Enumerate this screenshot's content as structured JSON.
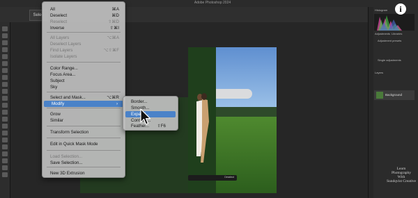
{
  "app": {
    "title": "Adobe Photoshop 2024"
  },
  "options_bar": {
    "select_label": "Selec"
  },
  "select_menu": {
    "items": [
      {
        "label": "All",
        "shortcut": "⌘A",
        "disabled": false
      },
      {
        "label": "Deselect",
        "shortcut": "⌘D",
        "disabled": false
      },
      {
        "label": "Reselect",
        "shortcut": "⇧⌘D",
        "disabled": true
      },
      {
        "label": "Inverse",
        "shortcut": "⇧⌘I",
        "disabled": false
      },
      {
        "label": "All Layers",
        "shortcut": "⌥⌘A",
        "disabled": true
      },
      {
        "label": "Deselect Layers",
        "shortcut": "",
        "disabled": true
      },
      {
        "label": "Find Layers",
        "shortcut": "⌥⇧⌘F",
        "disabled": true
      },
      {
        "label": "Isolate Layers",
        "shortcut": "",
        "disabled": true
      },
      {
        "label": "Color Range...",
        "shortcut": "",
        "disabled": false
      },
      {
        "label": "Focus Area...",
        "shortcut": "",
        "disabled": false
      },
      {
        "label": "Subject",
        "shortcut": "",
        "disabled": false
      },
      {
        "label": "Sky",
        "shortcut": "",
        "disabled": false
      },
      {
        "label": "Select and Mask...",
        "shortcut": "⌥⌘R",
        "disabled": false
      },
      {
        "label": "Modify",
        "shortcut": "›",
        "disabled": false,
        "highlighted": true
      },
      {
        "label": "Grow",
        "shortcut": "",
        "disabled": false
      },
      {
        "label": "Similar",
        "shortcut": "",
        "disabled": false
      },
      {
        "label": "Transform Selection",
        "shortcut": "",
        "disabled": false
      },
      {
        "label": "Edit in Quick Mask Mode",
        "shortcut": "",
        "disabled": false
      },
      {
        "label": "Load Selection...",
        "shortcut": "",
        "disabled": true
      },
      {
        "label": "Save Selection...",
        "shortcut": "",
        "disabled": false
      },
      {
        "label": "New 3D Extrusion",
        "shortcut": "",
        "disabled": false
      }
    ]
  },
  "modify_submenu": {
    "items": [
      {
        "label": "Border...",
        "highlighted": false
      },
      {
        "label": "Smooth...",
        "highlighted": false
      },
      {
        "label": "Expand...",
        "highlighted": true
      },
      {
        "label": "Contract...",
        "highlighted": false
      },
      {
        "label": "Feather...",
        "shortcut": "⇧F6",
        "highlighted": false
      }
    ]
  },
  "panels": {
    "histogram_tab": "Histogram",
    "adjustments_tab": "Adjustments",
    "libraries_tab": "Libraries",
    "adj_presets": "Adjustment presets",
    "single_adj": "Single adjustments",
    "layers_tab": "Layers",
    "layer_name": "Background"
  },
  "context_bar": {
    "deselect_label": "Deselect"
  },
  "info_icon": "i",
  "watermark": {
    "lines": [
      "Learn",
      "Photography",
      "With",
      "Sundqvist Creative"
    ]
  },
  "colors": {
    "highlight": "#4a82c8",
    "menu_bg": "#bebebe"
  }
}
